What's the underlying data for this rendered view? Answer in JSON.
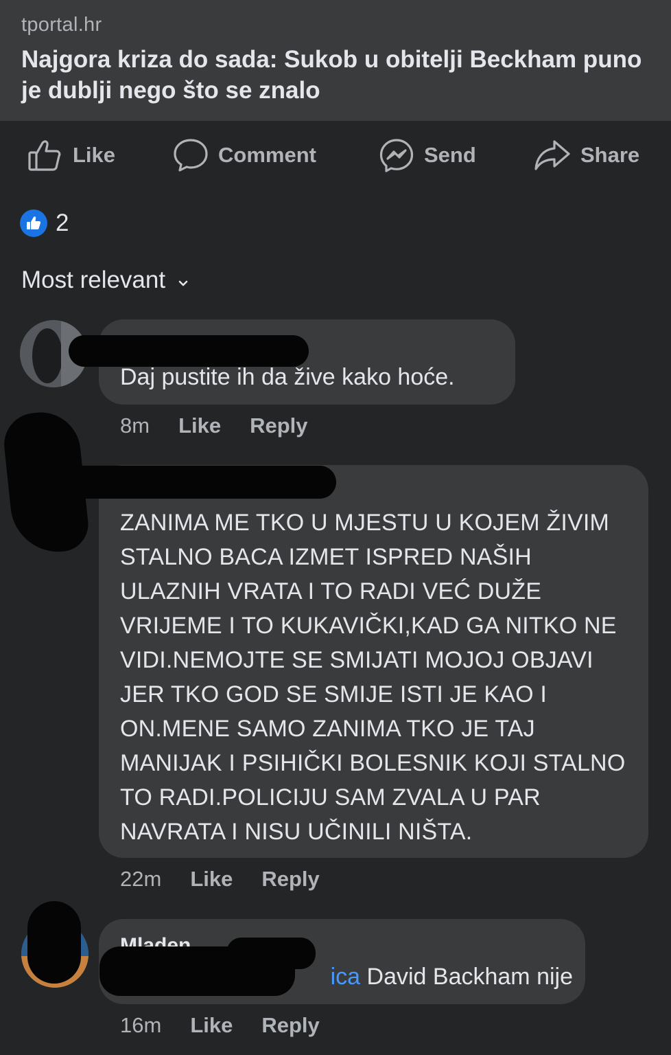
{
  "post": {
    "link": {
      "domain": "tportal.hr",
      "title": "Najgora kriza do sada: Sukob u obitelji Beckham puno je dublji nego što se znalo"
    },
    "actions": [
      {
        "label": "Like",
        "icon": "thumbs-up-icon"
      },
      {
        "label": "Comment",
        "icon": "comment-bubble-icon"
      },
      {
        "label": "Send",
        "icon": "messenger-icon"
      },
      {
        "label": "Share",
        "icon": "share-arrow-icon"
      }
    ],
    "reactions": {
      "count": "2",
      "icon": "like-reaction-icon",
      "color": "#1b74e4"
    }
  },
  "comments_section": {
    "sort_label": "Most relevant",
    "comments": [
      {
        "author": "",
        "text": "Daj pustite ih da žive kako hoće.",
        "time": "8m",
        "like_label": "Like",
        "reply_label": "Reply"
      },
      {
        "author": "",
        "text": "ZANIMA ME TKO U MJESTU U KOJEM ŽIVIM STALNO BACA IZMET ISPRED NAŠIH ULAZNIH VRATA I TO RADI VEĆ DUŽE VRIJEME I TO KUKAVIČKI,KAD GA NITKO NE VIDI.NEMOJTE SE SMIJATI MOJOJ OBJAVI JER TKO GOD SE SMIJE ISTI JE KAO I ON.MENE SAMO ZANIMA TKO JE TAJ MANIJAK I PSIHIČKI BOLESNIK KOJI STALNO TO RADI.POLICIJU SAM ZVALA U PAR NAVRATA I NISU UČINILI NIŠTA.",
        "time": "22m",
        "like_label": "Like",
        "reply_label": "Reply"
      },
      {
        "author": "Mladen",
        "mention": "ica",
        "text": " David Backham nije",
        "time": "16m",
        "like_label": "Like",
        "reply_label": "Reply"
      }
    ]
  }
}
